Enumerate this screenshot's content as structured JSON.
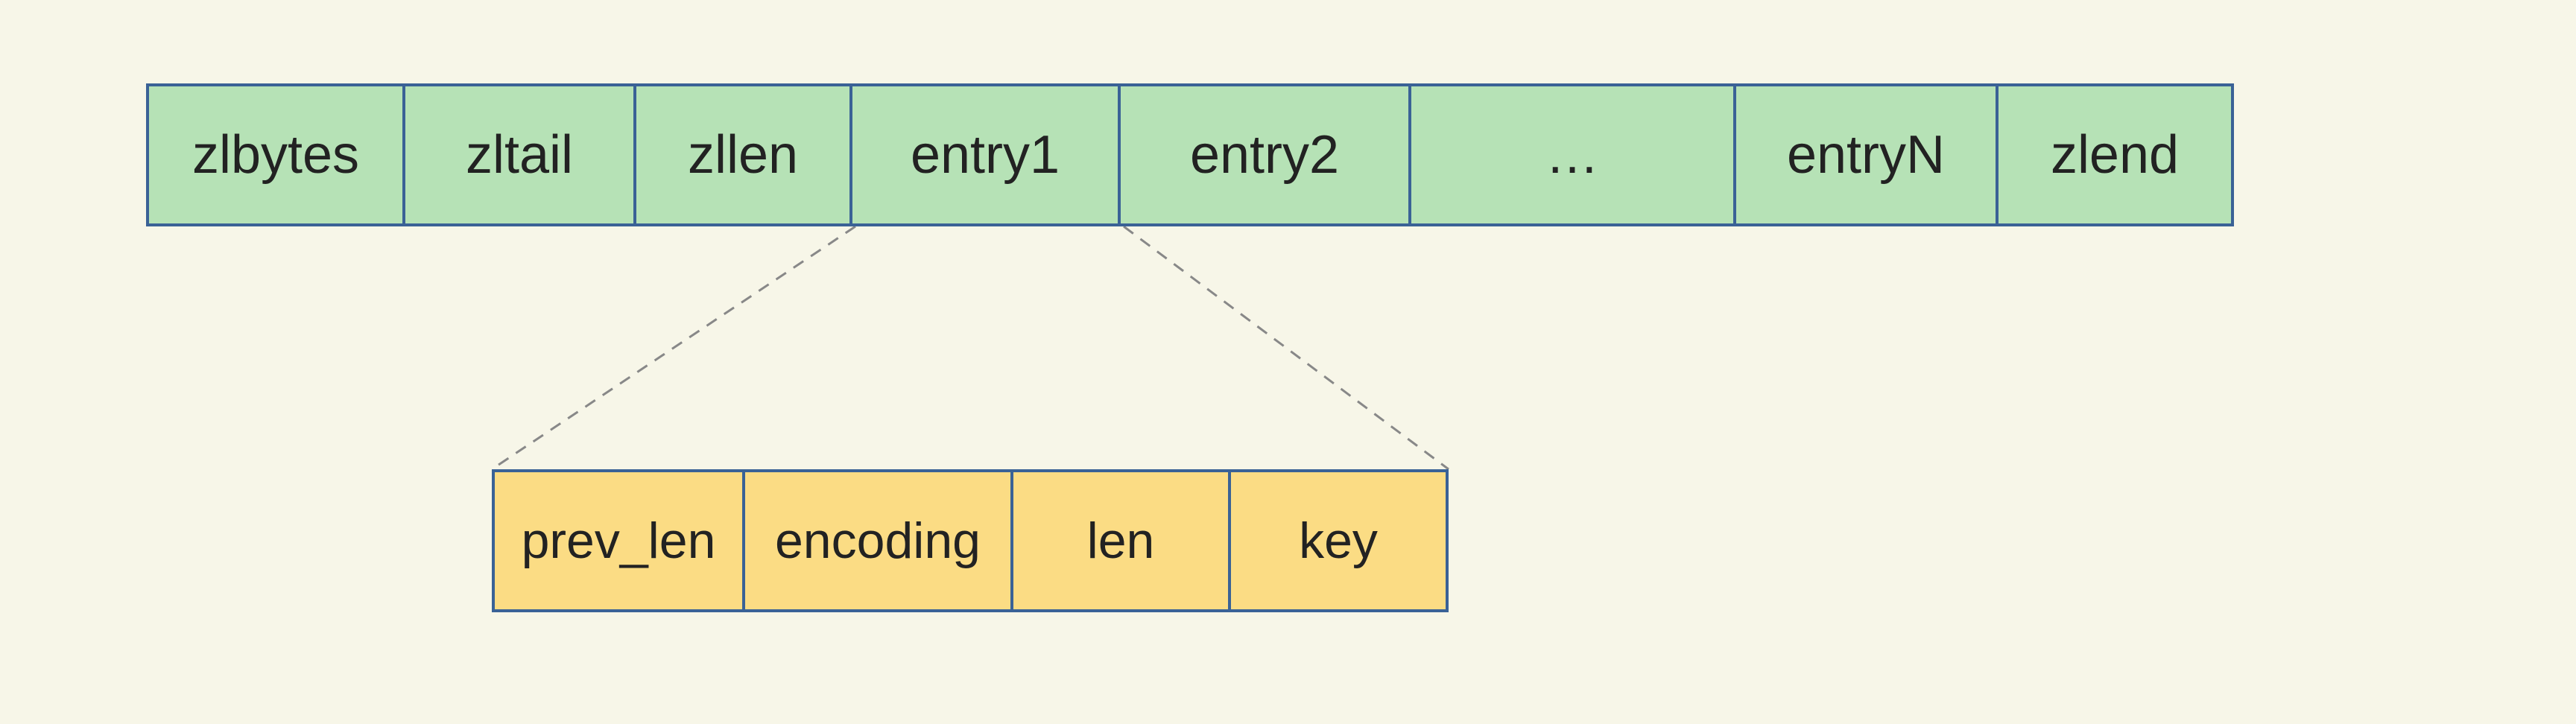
{
  "diagram": {
    "top_row": {
      "zlbytes": "zlbytes",
      "zltail": "zltail",
      "zllen": "zllen",
      "entry1": "entry1",
      "entry2": "entry2",
      "dots": "…",
      "entryn": "entryN",
      "zlend": "zlend"
    },
    "bottom_row": {
      "prev_len": "prev_len",
      "encoding": "encoding",
      "len": "len",
      "key": "key"
    }
  }
}
